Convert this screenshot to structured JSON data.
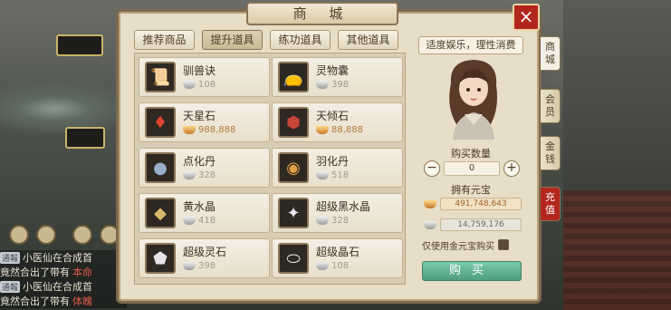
{
  "window": {
    "title": "商 城",
    "close_icon": "×",
    "tabs": [
      {
        "label": "推荐商品",
        "active": false
      },
      {
        "label": "提升道具",
        "active": true
      },
      {
        "label": "练功道具",
        "active": false
      },
      {
        "label": "其他道具",
        "active": false
      }
    ]
  },
  "items": [
    {
      "name": "驯兽诀",
      "price": "108",
      "currency": "silver",
      "icon": "scroll-icon",
      "glyph": "📜"
    },
    {
      "name": "灵物囊",
      "price": "398",
      "currency": "silver",
      "icon": "pouch-icon",
      "glyph": "👝"
    },
    {
      "name": "天星石",
      "price": "988,888",
      "currency": "gold",
      "icon": "red-crystal-icon",
      "glyph": "♦"
    },
    {
      "name": "天倾石",
      "price": "88,888",
      "currency": "gold",
      "icon": "dark-stone-icon",
      "glyph": "⬢"
    },
    {
      "name": "点化丹",
      "price": "328",
      "currency": "silver",
      "icon": "pill-icon",
      "glyph": "●"
    },
    {
      "name": "羽化丹",
      "price": "518",
      "currency": "silver",
      "icon": "golden-pill-icon",
      "glyph": "◉"
    },
    {
      "name": "黄水晶",
      "price": "418",
      "currency": "silver",
      "icon": "yellow-crystal-icon",
      "glyph": "◆"
    },
    {
      "name": "超级黑水晶",
      "price": "328",
      "currency": "silver",
      "icon": "black-crystal-icon",
      "glyph": "✦"
    },
    {
      "name": "超级灵石",
      "price": "398",
      "currency": "silver",
      "icon": "spirit-stone-icon",
      "glyph": "⬟"
    },
    {
      "name": "超级晶石",
      "price": "108",
      "currency": "silver",
      "icon": "crystal-stone-icon",
      "glyph": "⬭"
    }
  ],
  "sidebar": {
    "slogan": "适度娱乐，理性消费",
    "qty_label": "购买数量",
    "qty_value": "0",
    "minus": "−",
    "plus": "+",
    "owned_label": "拥有元宝",
    "gold_amount": "491,748,643",
    "silver_amount": "14,759,176",
    "gold_only_label": "仅使用金元宝购买",
    "buy_label": "购买"
  },
  "side_tabs": [
    {
      "label": "商城",
      "active": true
    },
    {
      "label": "会员",
      "active": false
    },
    {
      "label": "金钱",
      "active": false
    },
    {
      "label": "充值",
      "active": false
    }
  ],
  "chat": [
    {
      "tag": "通報",
      "name": "小医仙在合成首",
      "extra": ""
    },
    {
      "tag": "",
      "name": "竟然合出了带有",
      "extra": "本命"
    },
    {
      "tag": "通報",
      "name": "小医仙在合成首",
      "extra": ""
    },
    {
      "tag": "",
      "name": "竟然合出了带有",
      "extra": "体魄"
    }
  ],
  "colors": {
    "accent_red": "#b3261e",
    "buy_green": "#5fae90",
    "panel_bg": "#e8ddc7"
  }
}
